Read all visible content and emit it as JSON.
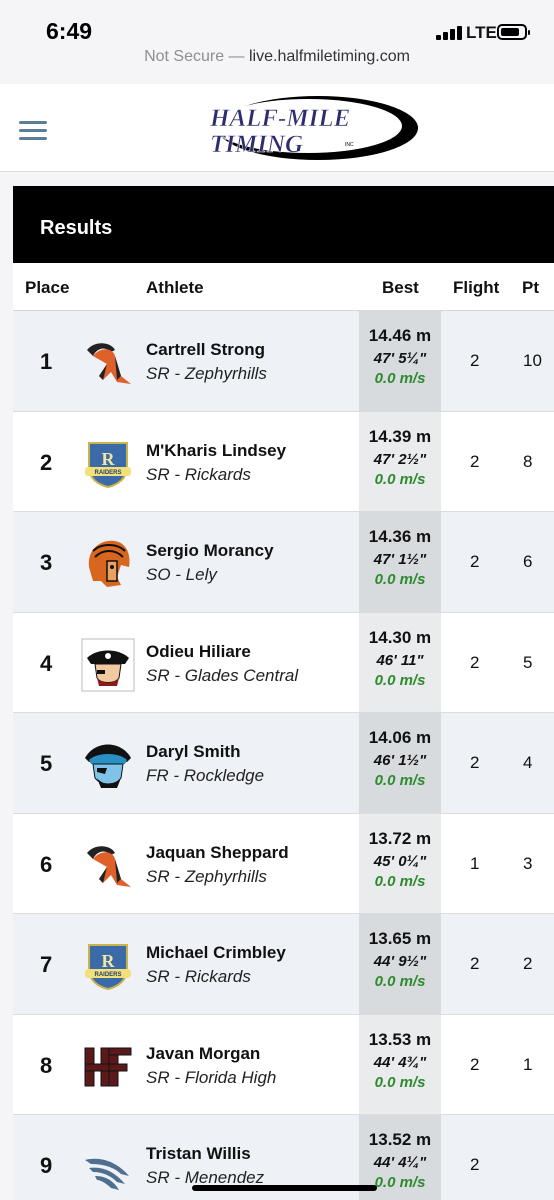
{
  "status_bar": {
    "time": "6:49",
    "network": "LTE"
  },
  "browser": {
    "security": "Not Secure",
    "separator": " — ",
    "domain": "live.halfmiletiming.com"
  },
  "header": {
    "logo_line1": "HALF-MILE",
    "logo_line2": "TIMING",
    "logo_suffix": "INC"
  },
  "results": {
    "title": "Results",
    "columns": {
      "place": "Place",
      "athlete": "Athlete",
      "best": "Best",
      "flight": "Flight",
      "pts": "Pt"
    },
    "rows": [
      {
        "place": "1",
        "name": "Cartrell Strong",
        "team": "SR - Zephyrhills",
        "best_m": "14.46 m",
        "best_ft": "47' 5¼\"",
        "wind": "0.0 m/s",
        "flight": "2",
        "pts": "10",
        "logo": "zephyrhills-logo-icon"
      },
      {
        "place": "2",
        "name": "M'Kharis Lindsey",
        "team": "SR - Rickards",
        "best_m": "14.39 m",
        "best_ft": "47' 2½\"",
        "wind": "0.0 m/s",
        "flight": "2",
        "pts": "8",
        "logo": "rickards-logo-icon"
      },
      {
        "place": "3",
        "name": "Sergio Morancy",
        "team": "SO - Lely",
        "best_m": "14.36 m",
        "best_ft": "47' 1½\"",
        "wind": "0.0 m/s",
        "flight": "2",
        "pts": "6",
        "logo": "lely-logo-icon"
      },
      {
        "place": "4",
        "name": "Odieu Hiliare",
        "team": "SR - Glades Central",
        "best_m": "14.30 m",
        "best_ft": "46' 11\"",
        "wind": "0.0 m/s",
        "flight": "2",
        "pts": "5",
        "logo": "glades-central-logo-icon"
      },
      {
        "place": "5",
        "name": "Daryl Smith",
        "team": "FR - Rockledge",
        "best_m": "14.06 m",
        "best_ft": "46' 1½\"",
        "wind": "0.0 m/s",
        "flight": "2",
        "pts": "4",
        "logo": "rockledge-logo-icon"
      },
      {
        "place": "6",
        "name": "Jaquan Sheppard",
        "team": "SR - Zephyrhills",
        "best_m": "13.72 m",
        "best_ft": "45' 0¼\"",
        "wind": "0.0 m/s",
        "flight": "1",
        "pts": "3",
        "logo": "zephyrhills-logo-icon"
      },
      {
        "place": "7",
        "name": "Michael Crimbley",
        "team": "SR - Rickards",
        "best_m": "13.65 m",
        "best_ft": "44' 9½\"",
        "wind": "0.0 m/s",
        "flight": "2",
        "pts": "2",
        "logo": "rickards-logo-icon"
      },
      {
        "place": "8",
        "name": "Javan Morgan",
        "team": "SR - Florida High",
        "best_m": "13.53 m",
        "best_ft": "44' 4¾\"",
        "wind": "0.0 m/s",
        "flight": "2",
        "pts": "1",
        "logo": "florida-high-logo-icon"
      },
      {
        "place": "9",
        "name": "Tristan Willis",
        "team": "SR - Menendez",
        "best_m": "13.52 m",
        "best_ft": "44' 4¼\"",
        "wind": "0.0 m/s",
        "flight": "2",
        "pts": "",
        "logo": "menendez-logo-icon"
      }
    ]
  }
}
